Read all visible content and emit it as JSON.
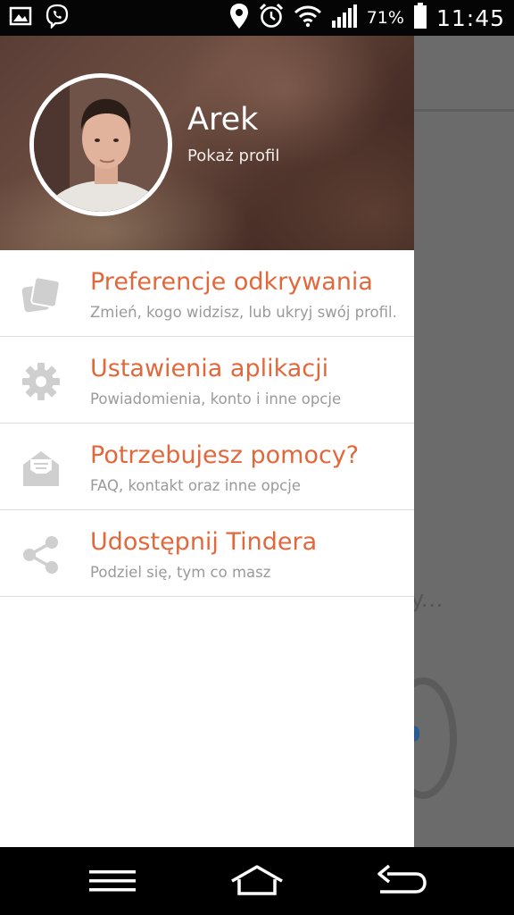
{
  "status_bar": {
    "icons_left": [
      "gallery-icon",
      "viber-icon"
    ],
    "icons_right": [
      "location-icon",
      "alarm-icon",
      "wifi-icon",
      "signal-icon",
      "battery-icon"
    ],
    "battery": "71%",
    "time": "11:45"
  },
  "drawer": {
    "user": {
      "name": "Arek",
      "profile_link": "Pokaż profil"
    },
    "items": [
      {
        "icon": "cards-icon",
        "title": "Preferencje odkrywania",
        "subtitle": "Zmień, kogo widzisz, lub ukryj swój profil."
      },
      {
        "icon": "gear-icon",
        "title": "Ustawienia aplikacji",
        "subtitle": "Powiadomienia, konto i inne opcje"
      },
      {
        "icon": "envelope-icon",
        "title": "Potrzebujesz pomocy?",
        "subtitle": "FAQ, kontakt oraz inne opcje"
      },
      {
        "icon": "share-icon",
        "title": "Udostępnij Tindera",
        "subtitle": "Podziel się, tym co masz"
      }
    ]
  },
  "background": {
    "partial_text": "y..."
  },
  "nav_bar": [
    "menu-icon",
    "home-icon",
    "back-icon"
  ],
  "colors": {
    "accent": "#e2683c",
    "subtitle": "#9a9a9a",
    "icon": "#cfcfcf"
  }
}
